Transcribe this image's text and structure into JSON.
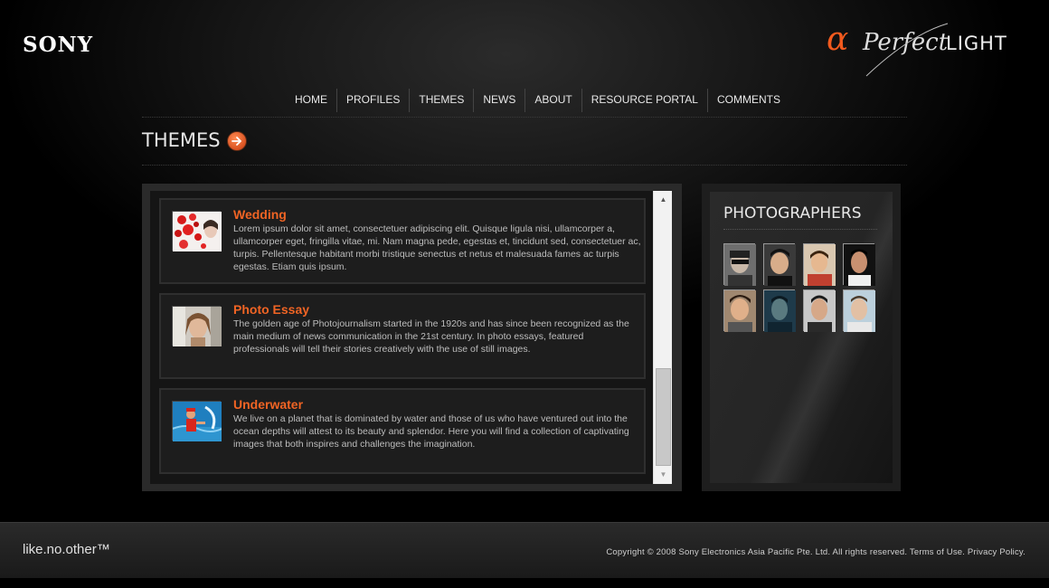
{
  "header": {
    "brand": "SONY",
    "campaign": {
      "alpha": "α",
      "perfect": "Perfect",
      "light": "LIGHT"
    }
  },
  "nav": {
    "items": [
      "HOME",
      "PROFILES",
      "THEMES",
      "NEWS",
      "ABOUT",
      "RESOURCE PORTAL",
      "COMMENTS"
    ]
  },
  "section": {
    "title": "THEMES"
  },
  "themes": [
    {
      "title": "Wedding",
      "description": "Lorem ipsum dolor sit amet, consectetuer adipiscing elit. Quisque ligula nisi, ullamcorper a, ullamcorper eget, fringilla vitae, mi. Nam magna pede, egestas et, tincidunt sed, consectetuer ac, turpis. Pellentesque habitant morbi tristique senectus et netus et malesuada fames ac turpis egestas. Etiam quis ipsum."
    },
    {
      "title": "Photo Essay",
      "description": "The golden age of Photojournalism started in the 1920s and has since been recognized as the main medium of news communication in the 21st century. In photo essays, featured professionals will tell their stories creatively with the use of still images."
    },
    {
      "title": "Underwater",
      "description": "We live on a planet that is dominated by water and those of us who have ventured out into the ocean depths will attest to its beauty and splendor. Here you will find a collection of captivating images that both inspires and challenges the imagination."
    }
  ],
  "photographers": {
    "title": "PHOTOGRAPHERS"
  },
  "footer": {
    "tagline": "like.no.other™",
    "copyright": "Copyright © 2008 Sony Electronics Asia Pacific Pte. Ltd. All rights reserved. Terms of Use. Privacy Policy."
  },
  "colors": {
    "accent": "#f06424",
    "background": "#000000"
  }
}
